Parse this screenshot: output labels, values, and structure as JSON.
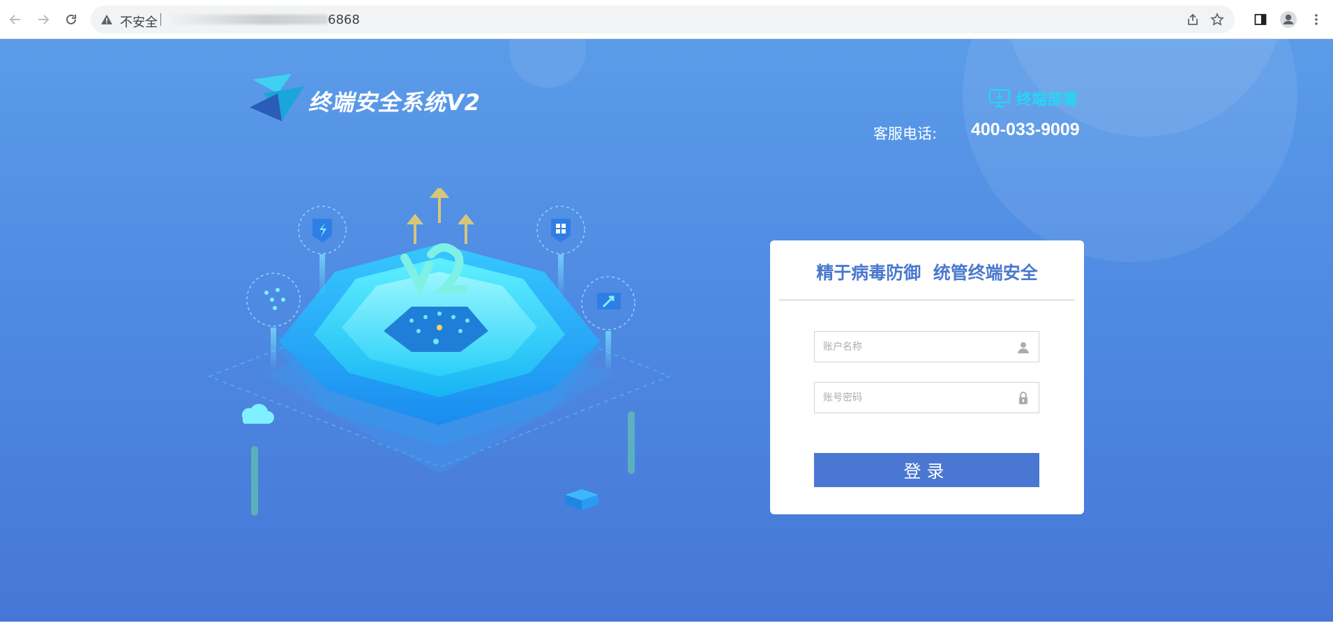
{
  "browser": {
    "security_label": "不安全",
    "url_suffix": "6868",
    "icons": {
      "back": "arrow-left-icon",
      "forward": "arrow-right-icon",
      "reload": "reload-icon",
      "warning": "warning-triangle-icon",
      "share": "share-icon",
      "bookmark": "star-icon",
      "sidepanel": "side-panel-icon",
      "profile": "avatar-icon",
      "menu": "kebab-menu-icon"
    }
  },
  "header": {
    "system_title": "终端安全系统V2",
    "deploy_label": "终端部署",
    "hotline_label": "客服电话:",
    "hotline_number": "400-033-9009"
  },
  "login": {
    "slogan": "精于病毒防御  统管终端安全",
    "username_placeholder": "账户名称",
    "password_placeholder": "账号密码",
    "submit_label": "登录"
  },
  "colors": {
    "background_top": "#5b9ce9",
    "background_bottom": "#4677d7",
    "accent": "#4a77d1",
    "deploy_link": "#25d6f4",
    "title_blue": "#4a78cf"
  }
}
